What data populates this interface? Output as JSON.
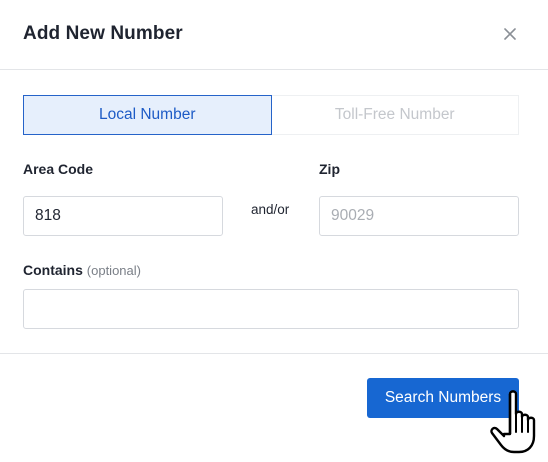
{
  "dialog": {
    "title": "Add New Number",
    "close_icon": "close-icon"
  },
  "tabs": [
    {
      "label": "Local Number",
      "active": true
    },
    {
      "label": "Toll-Free Number",
      "active": false
    }
  ],
  "form": {
    "area_code": {
      "label": "Area Code",
      "value": "818",
      "placeholder": ""
    },
    "separator": "and/or",
    "zip": {
      "label": "Zip",
      "value": "",
      "placeholder": "90029"
    },
    "contains": {
      "label": "Contains",
      "hint": "(optional)",
      "value": "",
      "placeholder": ""
    }
  },
  "actions": {
    "search_label": "Search Numbers"
  },
  "cursor_icon": "hand-pointer-icon",
  "colors": {
    "accent": "#1767d2",
    "tab_active_bg": "#e6effc",
    "tab_active_text": "#1d5bc6",
    "tab_inactive_text": "#c4c7cc"
  }
}
